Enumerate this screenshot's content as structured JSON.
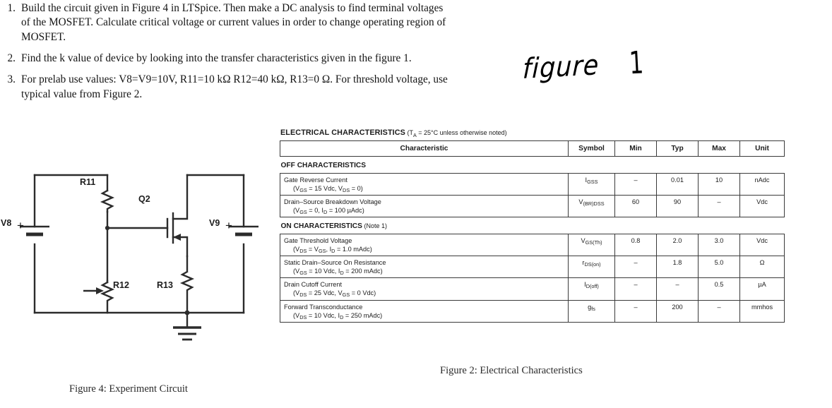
{
  "questions": [
    {
      "number": "1.",
      "lines": [
        "Build the circuit given in Figure 4 in LTSpice.  Then make a DC analysis to find terminal voltages",
        "of the MOSFET. Calculate critical voltage or current values in order to change operating region of",
        "MOSFET."
      ]
    },
    {
      "number": "2.",
      "lines": [
        "Find the k value of device by looking into the transfer characteristics given in the figure 1."
      ]
    },
    {
      "number": "3.",
      "lines": [
        "For prelab use values:  V8=V9=10V, R11=10 kΩ R12=40 kΩ, R13=0 Ω.  For threshold voltage, use",
        "typical value from Figure 2."
      ]
    }
  ],
  "handwriting": {
    "word": "figure",
    "number": "1"
  },
  "circuit": {
    "caption": "Figure 4: Experiment Circuit",
    "labels": {
      "v8": "V8",
      "v9": "V9",
      "r11": "R11",
      "r12": "R12",
      "r13": "R13",
      "q2": "Q2",
      "plus_left": "+",
      "plus_right": "+"
    }
  },
  "datasheet": {
    "caption": "Figure 2: Electrical Characteristics",
    "title_main": "ELECTRICAL CHARACTERISTICS",
    "title_cond_pre": "(T",
    "title_cond_sub": "A",
    "title_cond_post": " = 25°C unless otherwise noted)",
    "columns": [
      "Characteristic",
      "Symbol",
      "Min",
      "Typ",
      "Max",
      "Unit"
    ],
    "sections": [
      {
        "heading": "OFF CHARACTERISTICS",
        "note": "",
        "rows": [
          {
            "characteristic": "Gate Reverse Current",
            "condition_parts": [
              {
                "t": "(V"
              },
              {
                "s": "GS"
              },
              {
                "t": " = 15 Vdc, V"
              },
              {
                "s": "DS"
              },
              {
                "t": " = 0)"
              }
            ],
            "symbol_parts": [
              {
                "t": "I"
              },
              {
                "s": "GSS"
              }
            ],
            "min": "–",
            "typ": "0.01",
            "max": "10",
            "unit": "nAdc"
          },
          {
            "characteristic": "Drain–Source Breakdown Voltage",
            "condition_parts": [
              {
                "t": "(V"
              },
              {
                "s": "GS"
              },
              {
                "t": " = 0, I"
              },
              {
                "s": "D"
              },
              {
                "t": " = 100 µAdc)"
              }
            ],
            "symbol_parts": [
              {
                "t": "V"
              },
              {
                "s": "(BR)DSS"
              }
            ],
            "min": "60",
            "typ": "90",
            "max": "–",
            "unit": "Vdc"
          }
        ]
      },
      {
        "heading": "ON CHARACTERISTICS",
        "note": "(Note 1)",
        "rows": [
          {
            "characteristic": "Gate Threshold Voltage",
            "condition_parts": [
              {
                "t": "(V"
              },
              {
                "s": "DS"
              },
              {
                "t": " = V"
              },
              {
                "s": "GS"
              },
              {
                "t": ", I"
              },
              {
                "s": "D"
              },
              {
                "t": " = 1.0 mAdc)"
              }
            ],
            "symbol_parts": [
              {
                "t": "V"
              },
              {
                "s": "GS(Th)"
              }
            ],
            "min": "0.8",
            "typ": "2.0",
            "max": "3.0",
            "unit": "Vdc"
          },
          {
            "characteristic": "Static Drain–Source On Resistance",
            "condition_parts": [
              {
                "t": "(V"
              },
              {
                "s": "GS"
              },
              {
                "t": " = 10 Vdc, I"
              },
              {
                "s": "D"
              },
              {
                "t": " = 200 mAdc)"
              }
            ],
            "symbol_parts": [
              {
                "t": "r"
              },
              {
                "s": "DS(on)"
              }
            ],
            "min": "–",
            "typ": "1.8",
            "max": "5.0",
            "unit": "Ω"
          },
          {
            "characteristic": "Drain Cutoff Current",
            "condition_parts": [
              {
                "t": "(V"
              },
              {
                "s": "DS"
              },
              {
                "t": " = 25 Vdc, V"
              },
              {
                "s": "GS"
              },
              {
                "t": " = 0 Vdc)"
              }
            ],
            "symbol_parts": [
              {
                "t": "I"
              },
              {
                "s": "D(off)"
              }
            ],
            "min": "–",
            "typ": "–",
            "max": "0.5",
            "unit": "µA"
          },
          {
            "characteristic": "Forward Transconductance",
            "condition_parts": [
              {
                "t": "(V"
              },
              {
                "s": "DS"
              },
              {
                "t": " = 10 Vdc, I"
              },
              {
                "s": "D"
              },
              {
                "t": " = 250 mAdc)"
              }
            ],
            "symbol_parts": [
              {
                "t": "g"
              },
              {
                "s": "fs"
              }
            ],
            "min": "–",
            "typ": "200",
            "max": "–",
            "unit": "mmhos"
          }
        ]
      }
    ]
  },
  "colors": {
    "ink": "#141414",
    "rule": "#3a3a3a",
    "wire": "#2b2b2b",
    "caption": "#2a2a2a"
  }
}
